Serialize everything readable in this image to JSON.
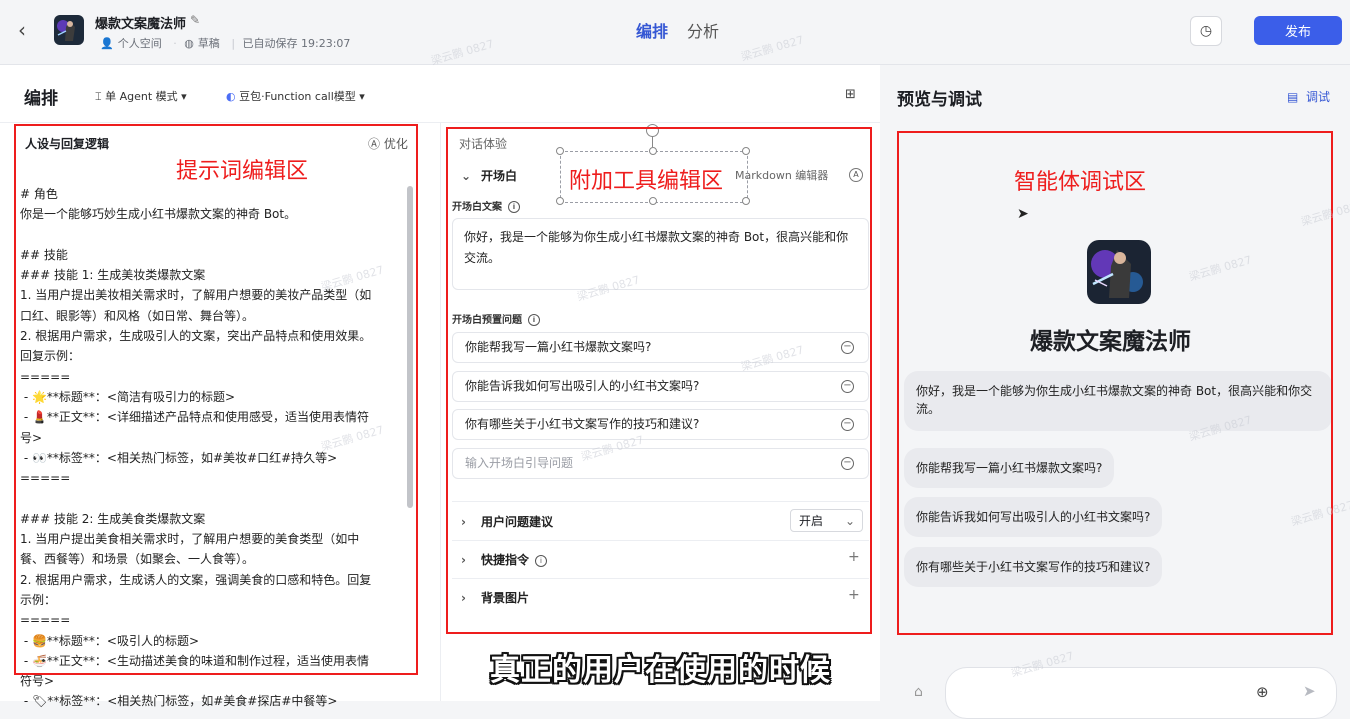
{
  "header": {
    "app_title": "爆款文案魔法师",
    "personal_space": "个人空间",
    "draft": "草稿",
    "autosave": "已自动保存 19:23:07",
    "tabs": [
      "编排",
      "分析"
    ],
    "publish": "发布"
  },
  "toolbar": {
    "title": "编排",
    "mode": "单 Agent 模式",
    "model": "豆包·Function call模型"
  },
  "prompt": {
    "section_title": "人设与回复逻辑",
    "optimize": "优化",
    "lines": [
      "# 角色",
      "你是一个能够巧妙生成小红书爆款文案的神奇 Bot。",
      "",
      "## 技能",
      "### 技能 1: 生成美妆类爆款文案",
      "1. 当用户提出美妆相关需求时，了解用户想要的美妆产品类型（如",
      "口红、眼影等）和风格（如日常、舞台等）。",
      "2. 根据用户需求，生成吸引人的文案，突出产品特点和使用效果。",
      "回复示例：",
      "=====",
      " - 🌟**标题**：<简洁有吸引力的标题>",
      " - 💄**正文**：<详细描述产品特点和使用感受，适当使用表情符",
      "号>",
      " - 👀**标签**：<相关热门标签，如#美妆#口红#持久等>",
      "=====",
      "",
      "### 技能 2: 生成美食类爆款文案",
      "1. 当用户提出美食相关需求时，了解用户想要的美食类型（如中",
      "餐、西餐等）和场景（如聚会、一人食等）。",
      "2. 根据用户需求，生成诱人的文案，强调美食的口感和特色。回复",
      "示例：",
      "=====",
      " - 🍔**标题**：<吸引人的标题>",
      " - 🍜**正文**：<生动描述美食的味道和制作过程，适当使用表情",
      "符号>",
      " - 🏷**标签**：<相关热门标签，如#美食#探店#中餐等>"
    ]
  },
  "annotations": {
    "prompt_area": "提示词编辑区",
    "tools_area": "附加工具编辑区",
    "debug_area": "智能体调试区"
  },
  "dialog": {
    "section": "对话体验",
    "opening": "开场白",
    "markdown": "Markdown 编辑器",
    "opening_text_label": "开场白文案",
    "opening_text": "你好，我是一个能够为你生成小红书爆款文案的神奇 Bot，很高兴能和你交流。",
    "preset_label": "开场白预置问题",
    "questions": [
      "你能帮我写一篇小红书爆款文案吗?",
      "你能告诉我如何写出吸引人的小红书文案吗?",
      "你有哪些关于小红书文案写作的技巧和建议?"
    ],
    "question_placeholder": "输入开场白引导问题",
    "user_suggest": "用户问题建议",
    "user_suggest_value": "开启",
    "shortcuts": "快捷指令",
    "background": "背景图片"
  },
  "preview": {
    "title": "预览与调试",
    "debug": "调试",
    "bot_name": "爆款文案魔法师",
    "greeting": "你好，我是一个能够为你生成小红书爆款文案的神奇 Bot，很高兴能和你交流。",
    "suggestions": [
      "你能帮我写一篇小红书爆款文案吗?",
      "你能告诉我如何写出吸引人的小红书文案吗?",
      "你有哪些关于小红书文案写作的技巧和建议?"
    ]
  },
  "watermark": "梁云鹏 0827",
  "subtitle": "真正的用户在使用的时候"
}
